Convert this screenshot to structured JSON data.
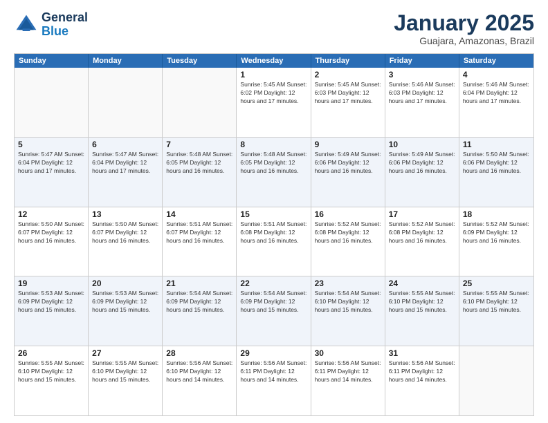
{
  "logo": {
    "line1": "General",
    "line2": "Blue"
  },
  "calendar": {
    "title": "January 2025",
    "subtitle": "Guajara, Amazonas, Brazil",
    "headers": [
      "Sunday",
      "Monday",
      "Tuesday",
      "Wednesday",
      "Thursday",
      "Friday",
      "Saturday"
    ],
    "weeks": [
      {
        "alt": false,
        "cells": [
          {
            "day": "",
            "info": ""
          },
          {
            "day": "",
            "info": ""
          },
          {
            "day": "",
            "info": ""
          },
          {
            "day": "1",
            "info": "Sunrise: 5:45 AM\nSunset: 6:02 PM\nDaylight: 12 hours and 17 minutes."
          },
          {
            "day": "2",
            "info": "Sunrise: 5:45 AM\nSunset: 6:03 PM\nDaylight: 12 hours and 17 minutes."
          },
          {
            "day": "3",
            "info": "Sunrise: 5:46 AM\nSunset: 6:03 PM\nDaylight: 12 hours and 17 minutes."
          },
          {
            "day": "4",
            "info": "Sunrise: 5:46 AM\nSunset: 6:04 PM\nDaylight: 12 hours and 17 minutes."
          }
        ]
      },
      {
        "alt": true,
        "cells": [
          {
            "day": "5",
            "info": "Sunrise: 5:47 AM\nSunset: 6:04 PM\nDaylight: 12 hours and 17 minutes."
          },
          {
            "day": "6",
            "info": "Sunrise: 5:47 AM\nSunset: 6:04 PM\nDaylight: 12 hours and 17 minutes."
          },
          {
            "day": "7",
            "info": "Sunrise: 5:48 AM\nSunset: 6:05 PM\nDaylight: 12 hours and 16 minutes."
          },
          {
            "day": "8",
            "info": "Sunrise: 5:48 AM\nSunset: 6:05 PM\nDaylight: 12 hours and 16 minutes."
          },
          {
            "day": "9",
            "info": "Sunrise: 5:49 AM\nSunset: 6:06 PM\nDaylight: 12 hours and 16 minutes."
          },
          {
            "day": "10",
            "info": "Sunrise: 5:49 AM\nSunset: 6:06 PM\nDaylight: 12 hours and 16 minutes."
          },
          {
            "day": "11",
            "info": "Sunrise: 5:50 AM\nSunset: 6:06 PM\nDaylight: 12 hours and 16 minutes."
          }
        ]
      },
      {
        "alt": false,
        "cells": [
          {
            "day": "12",
            "info": "Sunrise: 5:50 AM\nSunset: 6:07 PM\nDaylight: 12 hours and 16 minutes."
          },
          {
            "day": "13",
            "info": "Sunrise: 5:50 AM\nSunset: 6:07 PM\nDaylight: 12 hours and 16 minutes."
          },
          {
            "day": "14",
            "info": "Sunrise: 5:51 AM\nSunset: 6:07 PM\nDaylight: 12 hours and 16 minutes."
          },
          {
            "day": "15",
            "info": "Sunrise: 5:51 AM\nSunset: 6:08 PM\nDaylight: 12 hours and 16 minutes."
          },
          {
            "day": "16",
            "info": "Sunrise: 5:52 AM\nSunset: 6:08 PM\nDaylight: 12 hours and 16 minutes."
          },
          {
            "day": "17",
            "info": "Sunrise: 5:52 AM\nSunset: 6:08 PM\nDaylight: 12 hours and 16 minutes."
          },
          {
            "day": "18",
            "info": "Sunrise: 5:52 AM\nSunset: 6:09 PM\nDaylight: 12 hours and 16 minutes."
          }
        ]
      },
      {
        "alt": true,
        "cells": [
          {
            "day": "19",
            "info": "Sunrise: 5:53 AM\nSunset: 6:09 PM\nDaylight: 12 hours and 15 minutes."
          },
          {
            "day": "20",
            "info": "Sunrise: 5:53 AM\nSunset: 6:09 PM\nDaylight: 12 hours and 15 minutes."
          },
          {
            "day": "21",
            "info": "Sunrise: 5:54 AM\nSunset: 6:09 PM\nDaylight: 12 hours and 15 minutes."
          },
          {
            "day": "22",
            "info": "Sunrise: 5:54 AM\nSunset: 6:09 PM\nDaylight: 12 hours and 15 minutes."
          },
          {
            "day": "23",
            "info": "Sunrise: 5:54 AM\nSunset: 6:10 PM\nDaylight: 12 hours and 15 minutes."
          },
          {
            "day": "24",
            "info": "Sunrise: 5:55 AM\nSunset: 6:10 PM\nDaylight: 12 hours and 15 minutes."
          },
          {
            "day": "25",
            "info": "Sunrise: 5:55 AM\nSunset: 6:10 PM\nDaylight: 12 hours and 15 minutes."
          }
        ]
      },
      {
        "alt": false,
        "cells": [
          {
            "day": "26",
            "info": "Sunrise: 5:55 AM\nSunset: 6:10 PM\nDaylight: 12 hours and 15 minutes."
          },
          {
            "day": "27",
            "info": "Sunrise: 5:55 AM\nSunset: 6:10 PM\nDaylight: 12 hours and 15 minutes."
          },
          {
            "day": "28",
            "info": "Sunrise: 5:56 AM\nSunset: 6:10 PM\nDaylight: 12 hours and 14 minutes."
          },
          {
            "day": "29",
            "info": "Sunrise: 5:56 AM\nSunset: 6:11 PM\nDaylight: 12 hours and 14 minutes."
          },
          {
            "day": "30",
            "info": "Sunrise: 5:56 AM\nSunset: 6:11 PM\nDaylight: 12 hours and 14 minutes."
          },
          {
            "day": "31",
            "info": "Sunrise: 5:56 AM\nSunset: 6:11 PM\nDaylight: 12 hours and 14 minutes."
          },
          {
            "day": "",
            "info": ""
          }
        ]
      }
    ]
  }
}
